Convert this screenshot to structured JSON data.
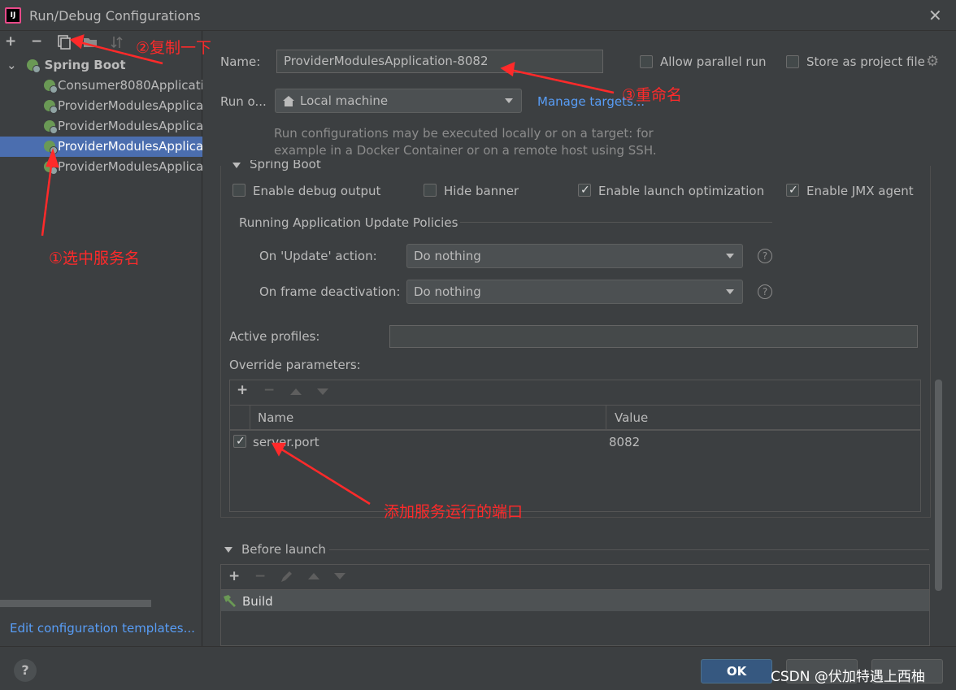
{
  "window": {
    "title": "Run/Debug Configurations"
  },
  "toolbar": {
    "add": "+",
    "remove": "−"
  },
  "tree": {
    "group": "Spring Boot",
    "items": [
      "Consumer8080Applicati",
      "ProviderModulesApplica",
      "ProviderModulesApplica",
      "ProviderModulesApplica",
      "ProviderModulesApplica"
    ]
  },
  "left": {
    "edit_templates": "Edit configuration templates..."
  },
  "form": {
    "name_label": "Name:",
    "name_value": "ProviderModulesApplication-8082",
    "allow_parallel": "Allow parallel run",
    "store_project": "Store as project file",
    "run_on_label": "Run o...",
    "run_on_value": "Local machine",
    "manage_targets": "Manage targets...",
    "hint_line1": "Run configurations may be executed locally or on a target: for",
    "hint_line2": "example in a Docker Container or on a remote host using SSH.",
    "spring_boot_section": "Spring Boot",
    "enable_debug": "Enable debug output",
    "hide_banner": "Hide banner",
    "enable_launch": "Enable launch optimization",
    "enable_jmx": "Enable JMX agent",
    "policies_title": "Running Application Update Policies",
    "on_update_label": "On 'Update' action:",
    "on_update_value": "Do nothing",
    "on_frame_label": "On frame deactivation:",
    "on_frame_value": "Do nothing",
    "active_profiles_label": "Active profiles:",
    "override_label": "Override parameters:",
    "col_name": "Name",
    "col_value": "Value",
    "row_name": "server.port",
    "row_value": "8082",
    "before_launch": "Before launch",
    "build": "Build"
  },
  "buttons": {
    "ok": "OK",
    "help": "?"
  },
  "annotations": {
    "a1": "①选中服务名",
    "a2": "②复制一下",
    "a3": "③重命名",
    "a4": "添加服务运行的端口"
  },
  "watermark": "CSDN @伏加特遇上西柚"
}
